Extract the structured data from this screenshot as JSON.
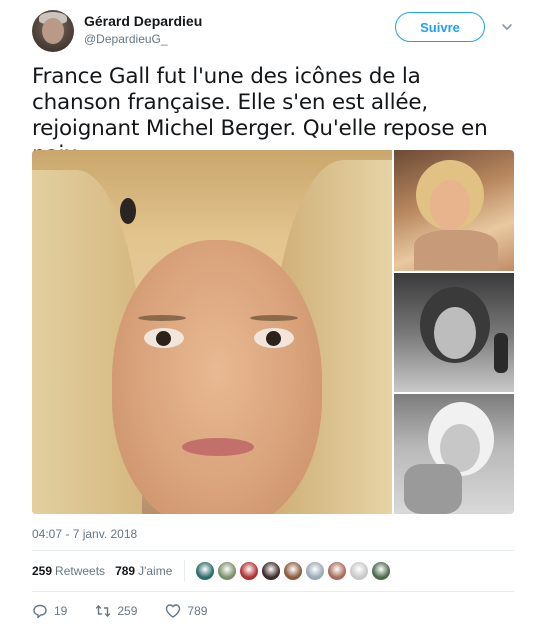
{
  "author": {
    "name": "Gérard Depardieu",
    "handle": "@DepardieuG_"
  },
  "follow_label": "Suivre",
  "tweet": {
    "text": "France Gall fut l'une des icônes de la chanson française. Elle s'en est allée, rejoignant Michel Berger. Qu'elle repose en paix.",
    "timestamp": "04:07 - 7 janv. 2018"
  },
  "stats": {
    "retweets_count": "259",
    "retweets_label": "Retweets",
    "likes_count": "789",
    "likes_label": "J'aime"
  },
  "likers": [
    {
      "color": "#2d6a6a"
    },
    {
      "color": "#7a8f6a"
    },
    {
      "color": "#b03030"
    },
    {
      "color": "#3a2a2a"
    },
    {
      "color": "#8a5a3a"
    },
    {
      "color": "#9aa8b8"
    },
    {
      "color": "#a86a5a"
    },
    {
      "color": "#c8c8c8"
    },
    {
      "color": "#4a6a4a"
    }
  ],
  "actions": {
    "reply_count": "19",
    "retweet_count": "259",
    "like_count": "789"
  },
  "colors": {
    "accent": "#1da1f2",
    "secondary_text": "#657786",
    "primary_text": "#14171a"
  }
}
